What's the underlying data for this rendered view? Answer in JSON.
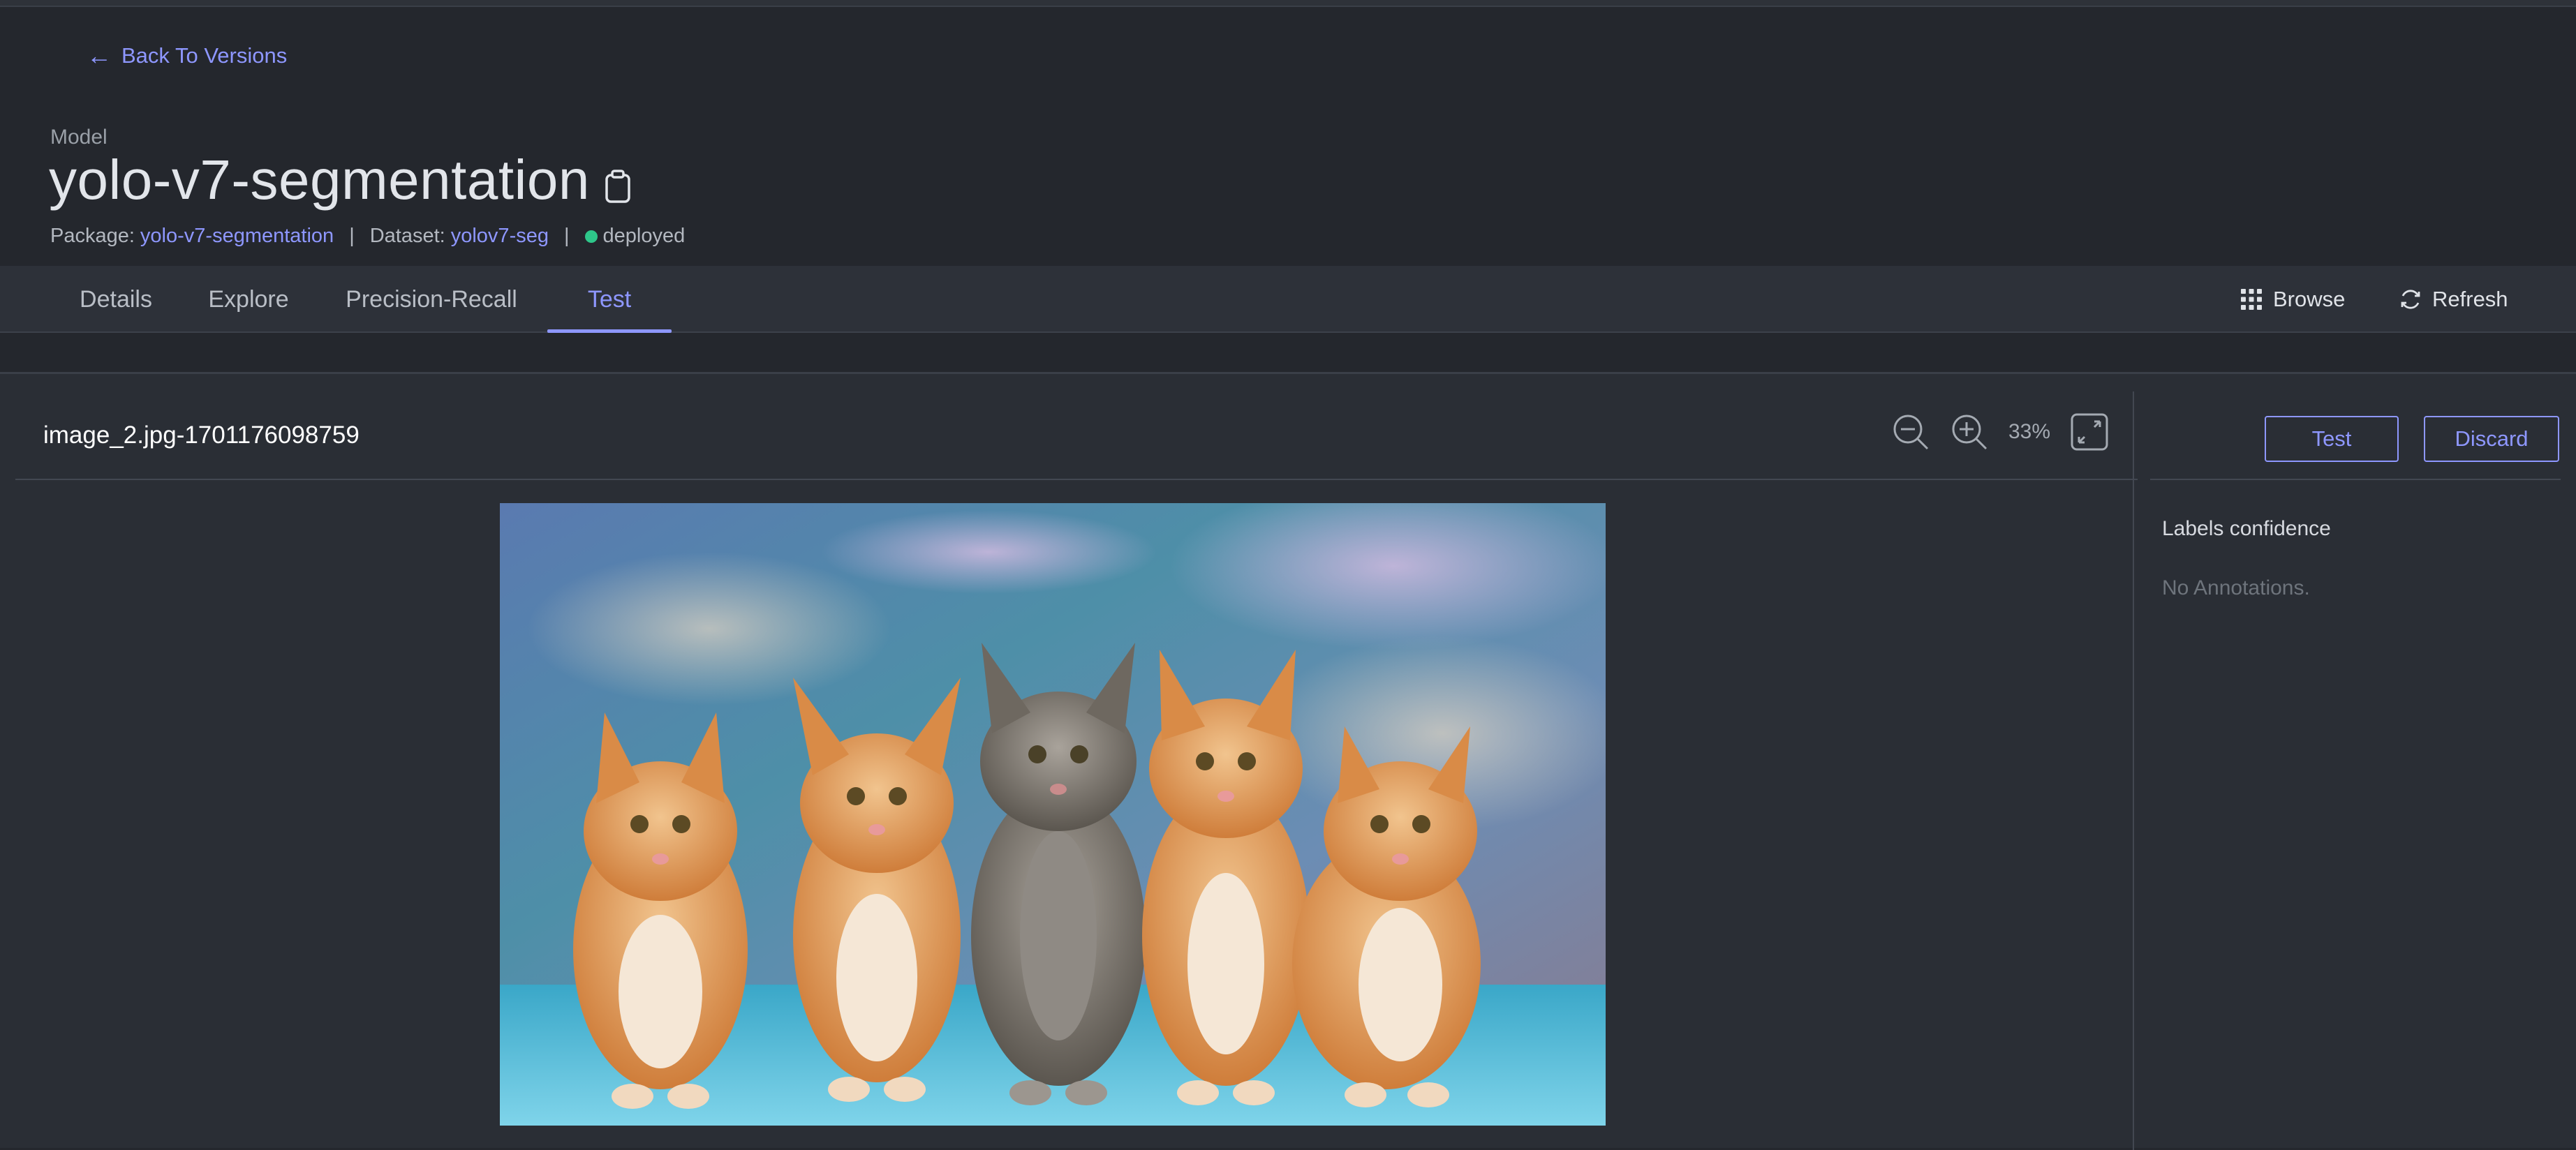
{
  "nav": {
    "back_label": "Back To Versions",
    "back_icon": "arrow-left-icon"
  },
  "header": {
    "kicker": "Model",
    "title": "yolo-v7-segmentation",
    "package_label": "Package:",
    "package_value": "yolo-v7-segmentation",
    "dataset_label": "Dataset:",
    "dataset_value": "yolov7-seg",
    "separator": "|",
    "status": "deployed",
    "status_color": "#2ec78a"
  },
  "tabs": [
    {
      "label": "Details"
    },
    {
      "label": "Explore"
    },
    {
      "label": "Precision-Recall"
    },
    {
      "label": "Test",
      "active": true
    }
  ],
  "toolbar": {
    "browse_label": "Browse",
    "refresh_label": "Refresh"
  },
  "viewer": {
    "filename": "image_2.jpg-1701176098759",
    "zoom": "33%"
  },
  "actions": {
    "test_label": "Test",
    "discard_label": "Discard"
  },
  "sidebar": {
    "title": "Labels confidence",
    "empty_text": "No Annotations."
  },
  "theme": {
    "accent": "#8e97ff",
    "background": "#24272d",
    "panel": "#2a2e35"
  }
}
